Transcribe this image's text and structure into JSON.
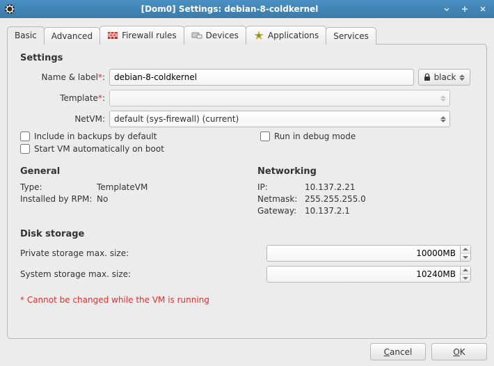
{
  "title": "[Dom0] Settings: debian-8-coldkernel",
  "tabs": [
    "Basic",
    "Advanced",
    "Firewall rules",
    "Devices",
    "Applications",
    "Services"
  ],
  "settings": {
    "heading": "Settings",
    "name_label": "Name & label",
    "name_value": "debian-8-coldkernel",
    "color_value": "black",
    "template_label": "Template",
    "template_value": "",
    "netvm_label": "NetVM:",
    "netvm_value": "default (sys-firewall) (current)",
    "checks": {
      "backups": "Include in backups by default",
      "debug": "Run in debug mode",
      "autostart": "Start VM automatically on boot"
    }
  },
  "general": {
    "heading": "General",
    "type_k": "Type:",
    "type_v": "TemplateVM",
    "rpm_k": "Installed by RPM:",
    "rpm_v": "No"
  },
  "networking": {
    "heading": "Networking",
    "ip_k": "IP:",
    "ip_v": "10.137.2.21",
    "mask_k": "Netmask:",
    "mask_v": "255.255.255.0",
    "gw_k": "Gateway:",
    "gw_v": "10.137.2.1"
  },
  "disk": {
    "heading": "Disk storage",
    "private_k": "Private storage max. size:",
    "private_v": "10000MB",
    "system_k": "System storage max. size:",
    "system_v": "10240MB"
  },
  "footnote": "Cannot be changed while the VM is running",
  "buttons": {
    "cancel": "Cancel",
    "ok": "OK"
  }
}
